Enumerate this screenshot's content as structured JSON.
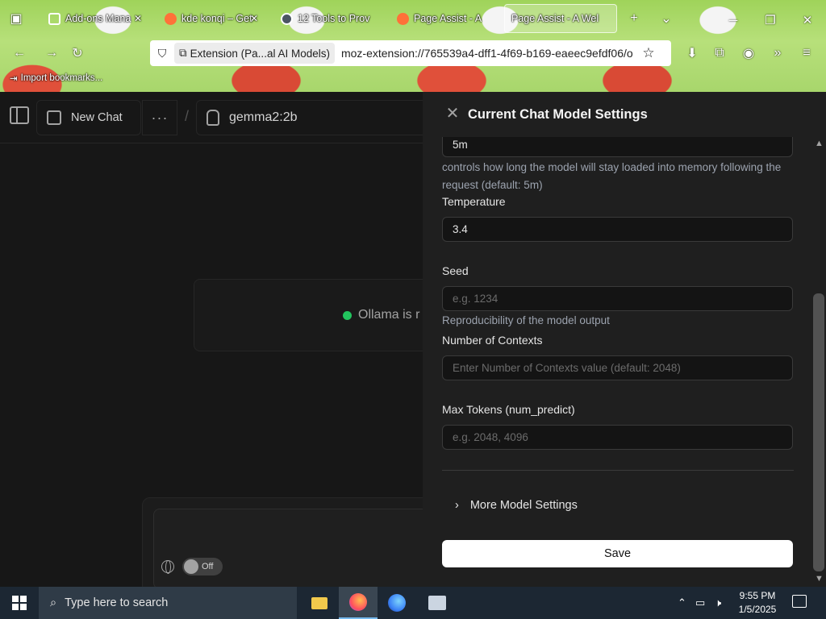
{
  "browser": {
    "tabs": [
      {
        "label": "Add-ons Mana",
        "favicon_color": "#6b7280"
      },
      {
        "label": "kde konqi – Get",
        "favicon_color": "#ff7139"
      },
      {
        "label": "12 Tools to Prov",
        "favicon_color": "#4b5563"
      },
      {
        "label": "Page Assist - A",
        "favicon_color": "#ff7139"
      },
      {
        "label": "Page Assist - A Wel",
        "favicon_color": "#444444"
      }
    ],
    "identity_label": "Extension (Pa...al AI Models)",
    "url": "moz-extension://765539a4-dff1-4f69-b169-eaeec9efdf06/o",
    "bookmark": "Import bookmarks..."
  },
  "app": {
    "new_chat_label": "New Chat",
    "more_label": "···",
    "separator": "/",
    "model_name": "gemma2:2b",
    "status_text": "Ollama is r",
    "web_toggle_label": "Off"
  },
  "drawer": {
    "title": "Current Chat Model Settings",
    "keep_alive_value": "5m",
    "keep_alive_help": "controls how long the model will stay loaded into memory following the request (default: 5m)",
    "temperature_label": "Temperature",
    "temperature_value": "3.4",
    "seed_label": "Seed",
    "seed_placeholder": "e.g. 1234",
    "seed_help": "Reproducibility of the model output",
    "contexts_label": "Number of Contexts",
    "contexts_placeholder": "Enter Number of Contexts value (default: 2048)",
    "max_tokens_label": "Max Tokens (num_predict)",
    "max_tokens_placeholder": "e.g. 2048, 4096",
    "more_settings_label": "More Model Settings",
    "save_label": "Save"
  },
  "taskbar": {
    "search_placeholder": "Type here to search",
    "time": "9:55 PM",
    "date": "1/5/2025"
  }
}
